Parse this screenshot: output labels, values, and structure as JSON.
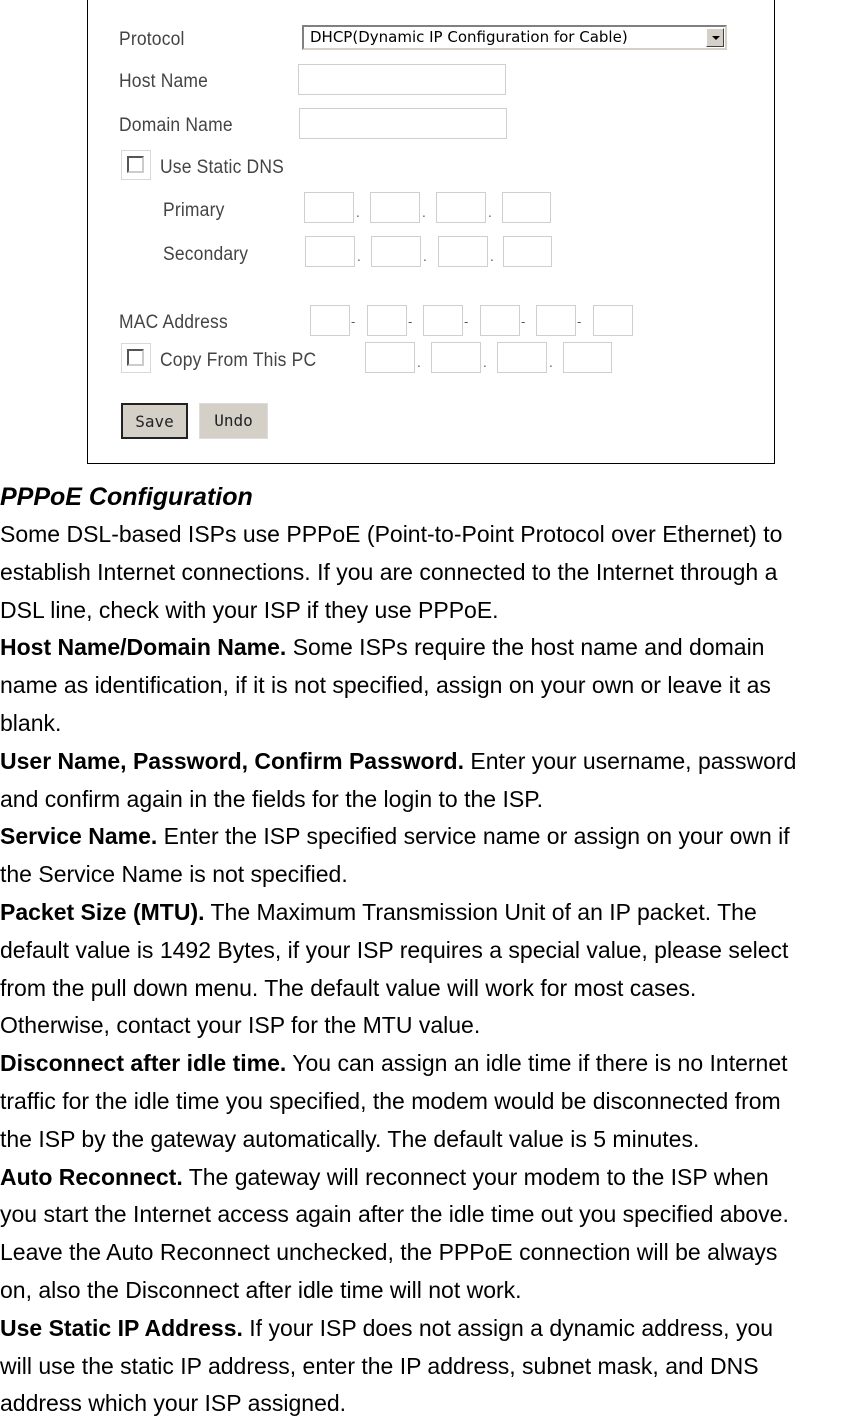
{
  "form": {
    "protocol_label": "Protocol",
    "protocol_value": "DHCP(Dynamic IP Configuration for Cable)",
    "host_name_label": "Host Name",
    "host_name_value": "",
    "domain_name_label": "Domain Name",
    "domain_name_value": "",
    "use_static_dns_label": "Use Static DNS",
    "use_static_dns_checked": false,
    "primary_label": "Primary",
    "secondary_label": "Secondary",
    "mac_address_label": "MAC Address",
    "copy_from_pc_label": "Copy From This PC",
    "copy_from_pc_checked": false,
    "ip_separator": ".",
    "mac_separator": "-",
    "save_label": "Save",
    "undo_label": "Undo"
  },
  "doc": {
    "title": "PPPoE Configuration",
    "lines": [
      {
        "bold": "",
        "text": "Some DSL-based ISPs use PPPoE (Point-to-Point Protocol over Ethernet) to"
      },
      {
        "bold": "",
        "text": "establish Internet connections. If you are connected to the Internet through a"
      },
      {
        "bold": "",
        "text": "DSL line, check with your ISP if they use PPPoE."
      },
      {
        "bold": "Host Name/Domain Name.",
        "text": " Some ISPs require the host name and domain"
      },
      {
        "bold": "",
        "text": "name as identification, if it is not specified, assign on your own or leave it as"
      },
      {
        "bold": "",
        "text": "blank."
      },
      {
        "bold": "User Name, Password, Confirm Password.",
        "text": " Enter your username, password"
      },
      {
        "bold": "",
        "text": "and confirm again in the fields for the login to the ISP."
      },
      {
        "bold": "Service Name.",
        "text": " Enter the ISP specified service name or assign on your own if"
      },
      {
        "bold": "",
        "text": "the Service Name is not specified."
      },
      {
        "bold": "Packet Size (MTU).",
        "text": " The Maximum Transmission Unit of an IP packet. The"
      },
      {
        "bold": "",
        "text": "default value is 1492 Bytes, if your ISP requires a special value, please select"
      },
      {
        "bold": "",
        "text": "from the pull down menu. The default value will work for most cases."
      },
      {
        "bold": "",
        "text": "Otherwise, contact your ISP for the MTU value."
      },
      {
        "bold": "Disconnect after idle time.",
        "text": " You can assign an idle time if there is no Internet"
      },
      {
        "bold": "",
        "text": "traffic for the idle time you specified, the modem would be disconnected from"
      },
      {
        "bold": "",
        "text": "the ISP by the gateway automatically. The default value is 5 minutes."
      },
      {
        "bold": "Auto Reconnect.",
        "text": " The gateway will reconnect your modem to the ISP when"
      },
      {
        "bold": "",
        "text": "you start the Internet access again after the idle time out you specified above."
      },
      {
        "bold": "",
        "text": "Leave the Auto Reconnect unchecked, the PPPoE connection will be always"
      },
      {
        "bold": "",
        "text": "on, also the Disconnect after idle time will not work."
      },
      {
        "bold": "Use Static IP Address.",
        "text": " If your ISP does not assign a dynamic address, you"
      },
      {
        "bold": "",
        "text": "will use the static IP address, enter the IP address, subnet mask, and DNS"
      },
      {
        "bold": "",
        "text": "address which your ISP assigned."
      }
    ]
  }
}
